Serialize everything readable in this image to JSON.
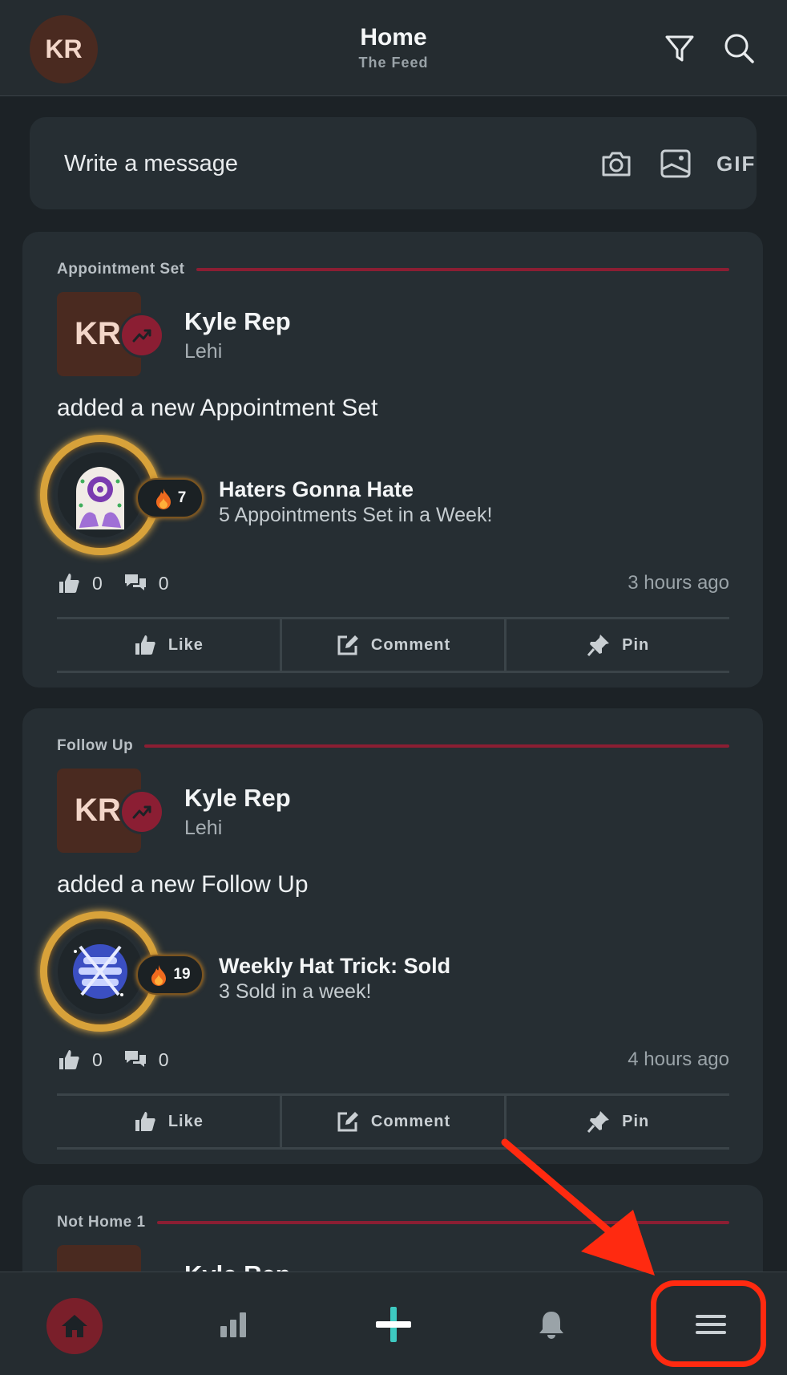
{
  "header": {
    "avatar_initials": "KR",
    "title": "Home",
    "subtitle": "The Feed",
    "icons": [
      "filter-icon",
      "search-icon"
    ]
  },
  "composer": {
    "placeholder": "Write a message",
    "gif_label": "GIF",
    "icons": [
      "camera-icon",
      "image-icon"
    ]
  },
  "posts": [
    {
      "category": "Appointment Set",
      "user_initials": "KR",
      "user_name": "Kyle Rep",
      "location": "Lehi",
      "action_text": "added a new Appointment Set",
      "achievement_title": "Haters Gonna Hate",
      "achievement_desc": "5 Appointments Set in a Week!",
      "streak": "7",
      "likes": "0",
      "comments": "0",
      "time_ago": "3 hours ago",
      "actions": [
        "Like",
        "Comment",
        "Pin"
      ]
    },
    {
      "category": "Follow Up",
      "user_initials": "KR",
      "user_name": "Kyle Rep",
      "location": "Lehi",
      "action_text": "added a new Follow Up",
      "achievement_title": "Weekly Hat Trick: Sold",
      "achievement_desc": "3 Sold in a week!",
      "streak": "19",
      "likes": "0",
      "comments": "0",
      "time_ago": "4 hours ago",
      "actions": [
        "Like",
        "Comment",
        "Pin"
      ]
    },
    {
      "category": "Not Home 1",
      "user_name": "Kyle Rep"
    }
  ],
  "bottom_nav": {
    "items": [
      "home-icon",
      "stats-icon",
      "add-icon",
      "bell-icon",
      "menu-icon"
    ],
    "active": "home-icon"
  },
  "colors": {
    "accent_red": "#8b1e33",
    "annotation_red": "#ff2a10",
    "add_teal": "#3ec9c0",
    "background": "#1c2226",
    "card": "#262e33"
  }
}
